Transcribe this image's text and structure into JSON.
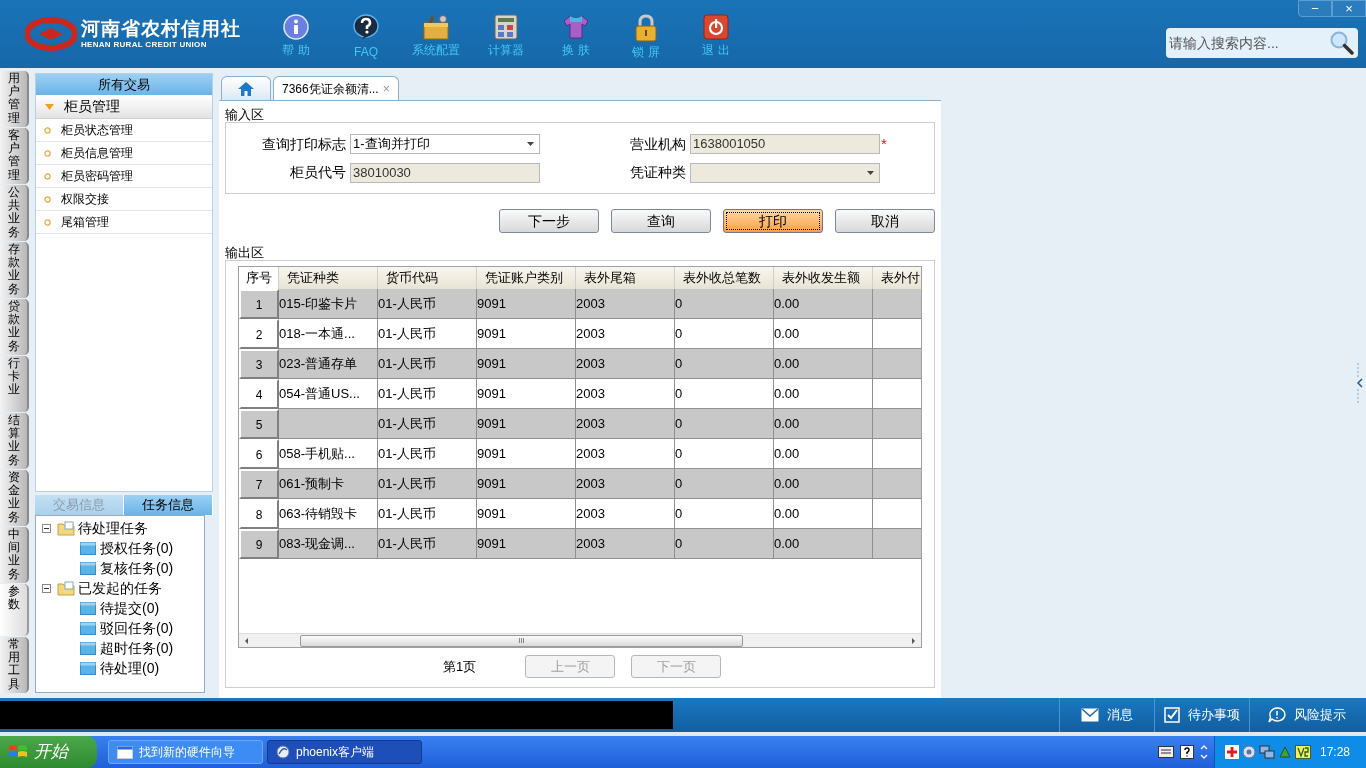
{
  "header": {
    "logo_title": "河南省农村信用社",
    "logo_subtitle": "HENAN RURAL CREDIT UNION",
    "toolbar": [
      {
        "kind": "info",
        "label": "帮 助"
      },
      {
        "kind": "faq",
        "label": "FAQ"
      },
      {
        "kind": "toolbox",
        "label": "系统配置"
      },
      {
        "kind": "calculator",
        "label": "计算器"
      },
      {
        "kind": "shirt",
        "label": "换 肤"
      },
      {
        "kind": "lock",
        "label": "锁 屏"
      },
      {
        "kind": "power",
        "label": "退 出"
      }
    ],
    "window_controls": [
      "−",
      "×"
    ],
    "search": {
      "placeholder": "请输入搜索内容..."
    }
  },
  "side_tabs": [
    {
      "label": "用户管理",
      "selected": false
    },
    {
      "label": "客户管理",
      "selected": false
    },
    {
      "label": "公共业务",
      "selected": false
    },
    {
      "label": "存款业务",
      "selected": false
    },
    {
      "label": "贷款业务",
      "selected": false
    },
    {
      "label": "行卡业",
      "selected": false
    },
    {
      "label": "结算业务",
      "selected": false
    },
    {
      "label": "资金业务",
      "selected": false
    },
    {
      "label": "中间业务",
      "selected": false
    },
    {
      "label": "参数",
      "selected": true
    },
    {
      "label": "常用工具",
      "selected": false
    }
  ],
  "menu": {
    "title": "所有交易",
    "group": {
      "label": "柜员管理",
      "expanded": true
    },
    "items": [
      "柜员状态管理",
      "柜员信息管理",
      "柜员密码管理",
      "权限交接",
      "尾箱管理"
    ]
  },
  "info_tabs": [
    {
      "label": "交易信息",
      "selected": false,
      "disabled": true
    },
    {
      "label": "任务信息",
      "selected": true,
      "disabled": false
    }
  ],
  "task_tree": [
    {
      "label": "待处理任务",
      "expanded": true,
      "children": [
        {
          "label": "授权任务(0)"
        },
        {
          "label": "复核任务(0)"
        }
      ]
    },
    {
      "label": "已发起的任务",
      "expanded": true,
      "children": [
        {
          "label": "待提交(0)"
        },
        {
          "label": "驳回任务(0)"
        },
        {
          "label": "超时任务(0)"
        },
        {
          "label": "待处理(0)"
        }
      ]
    }
  ],
  "doc_tabs": [
    {
      "kind": "home",
      "selected": false
    },
    {
      "kind": "page",
      "label": "7366凭证余额清...",
      "close": "×",
      "selected": true
    }
  ],
  "input_area": {
    "legend": "输入区",
    "fields": [
      {
        "label": "查询打印标志",
        "kind": "select",
        "value": "1-查询并打印",
        "disabled": false
      },
      {
        "label": "营业机构",
        "kind": "text",
        "value": "1638001050",
        "disabled": true,
        "required": "*"
      },
      {
        "label": "柜员代号",
        "kind": "text",
        "value": "38010030",
        "disabled": true
      },
      {
        "label": "凭证种类",
        "kind": "select",
        "disabled": true
      }
    ]
  },
  "buttons": [
    {
      "label": "下一步",
      "focused": false
    },
    {
      "label": "查询",
      "focused": false
    },
    {
      "label": "打印",
      "focused": true
    },
    {
      "label": "取消",
      "focused": false
    }
  ],
  "output_area": {
    "legend": "输出区",
    "table": {
      "columns": [
        "序号",
        "凭证种类",
        "货币代码",
        "凭证账户类别",
        "表外尾箱",
        "表外收总笔数",
        "表外收发生额",
        "表外付"
      ],
      "rows": [
        [
          "1",
          "015-印鉴卡片",
          "01-人民币",
          "9091",
          "2003",
          "0",
          "0.00"
        ],
        [
          "2",
          "018-一本通...",
          "01-人民币",
          "9091",
          "2003",
          "0",
          "0.00"
        ],
        [
          "3",
          "023-普通存单",
          "01-人民币",
          "9091",
          "2003",
          "0",
          "0.00"
        ],
        [
          "4",
          "054-普通US...",
          "01-人民币",
          "9091",
          "2003",
          "0",
          "0.00"
        ],
        [
          "5",
          null,
          "01-人民币",
          "9091",
          "2003",
          "0",
          "0.00"
        ],
        [
          "6",
          "058-手机贴...",
          "01-人民币",
          "9091",
          "2003",
          "0",
          "0.00"
        ],
        [
          "7",
          "061-预制卡",
          "01-人民币",
          "9091",
          "2003",
          "0",
          "0.00"
        ],
        [
          "8",
          "063-待销毁卡",
          "01-人民币",
          "9091",
          "2003",
          "0",
          "0.00"
        ],
        [
          "9",
          "083-现金调...",
          "01-人民币",
          "9091",
          "2003",
          "0",
          "0.00"
        ]
      ],
      "scroll_grip": "III"
    },
    "pager": {
      "page": "第1页",
      "prev": {
        "label": "上一页",
        "disabled": true
      },
      "next": {
        "label": "下一页",
        "disabled": true
      }
    }
  },
  "status_bar": [
    {
      "kind": "message",
      "label": "消息"
    },
    {
      "kind": "todo",
      "label": "待办事项"
    },
    {
      "kind": "risk",
      "label": "风险提示"
    }
  ],
  "taskbar": {
    "start": "开始",
    "windows": [
      {
        "label": "找到新的硬件向导",
        "selected": false
      },
      {
        "label": "phoenix客户端",
        "selected": true
      }
    ],
    "clock": "17:28"
  }
}
